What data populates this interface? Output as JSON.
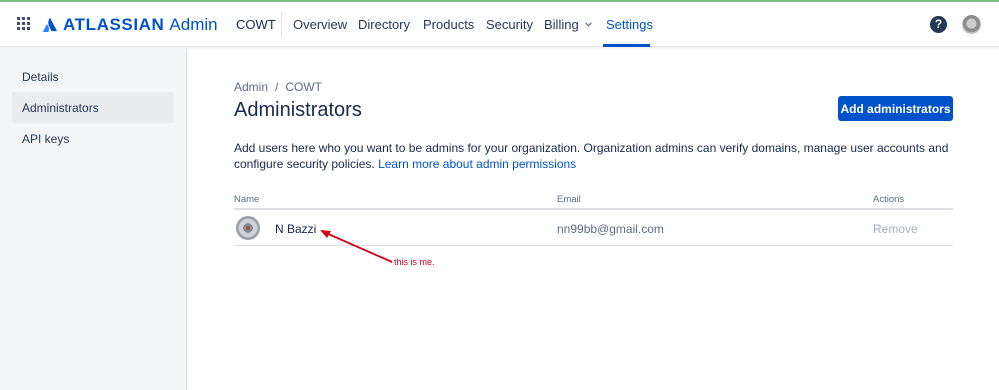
{
  "header": {
    "logo_word": "ATLASSIAN",
    "logo_suffix": "Admin",
    "org": "COWT",
    "nav": [
      "Overview",
      "Directory",
      "Products",
      "Security",
      "Billing",
      "Settings"
    ],
    "active_nav": "Settings",
    "help_label": "?"
  },
  "sidebar": {
    "items": [
      {
        "label": "Details"
      },
      {
        "label": "Administrators",
        "selected": true
      },
      {
        "label": "API keys"
      }
    ]
  },
  "main": {
    "breadcrumb": [
      "Admin",
      "/",
      "COWT"
    ],
    "title": "Administrators",
    "add_button": "Add administrators",
    "description": "Add users here who you want to be admins for your organization. Organization admins can verify domains, manage user accounts and configure security policies.",
    "learn_more": "Learn more about admin permissions",
    "table": {
      "columns": [
        "Name",
        "Email",
        "Actions"
      ],
      "rows": [
        {
          "name": "N Bazzi",
          "email": "nn99bb@gmail.com",
          "action": "Remove"
        }
      ]
    },
    "annotation": "this is me."
  },
  "colors": {
    "brand": "#0052cc",
    "annotation": "#d0021b",
    "sidebar_bg": "#f4f5f7"
  }
}
